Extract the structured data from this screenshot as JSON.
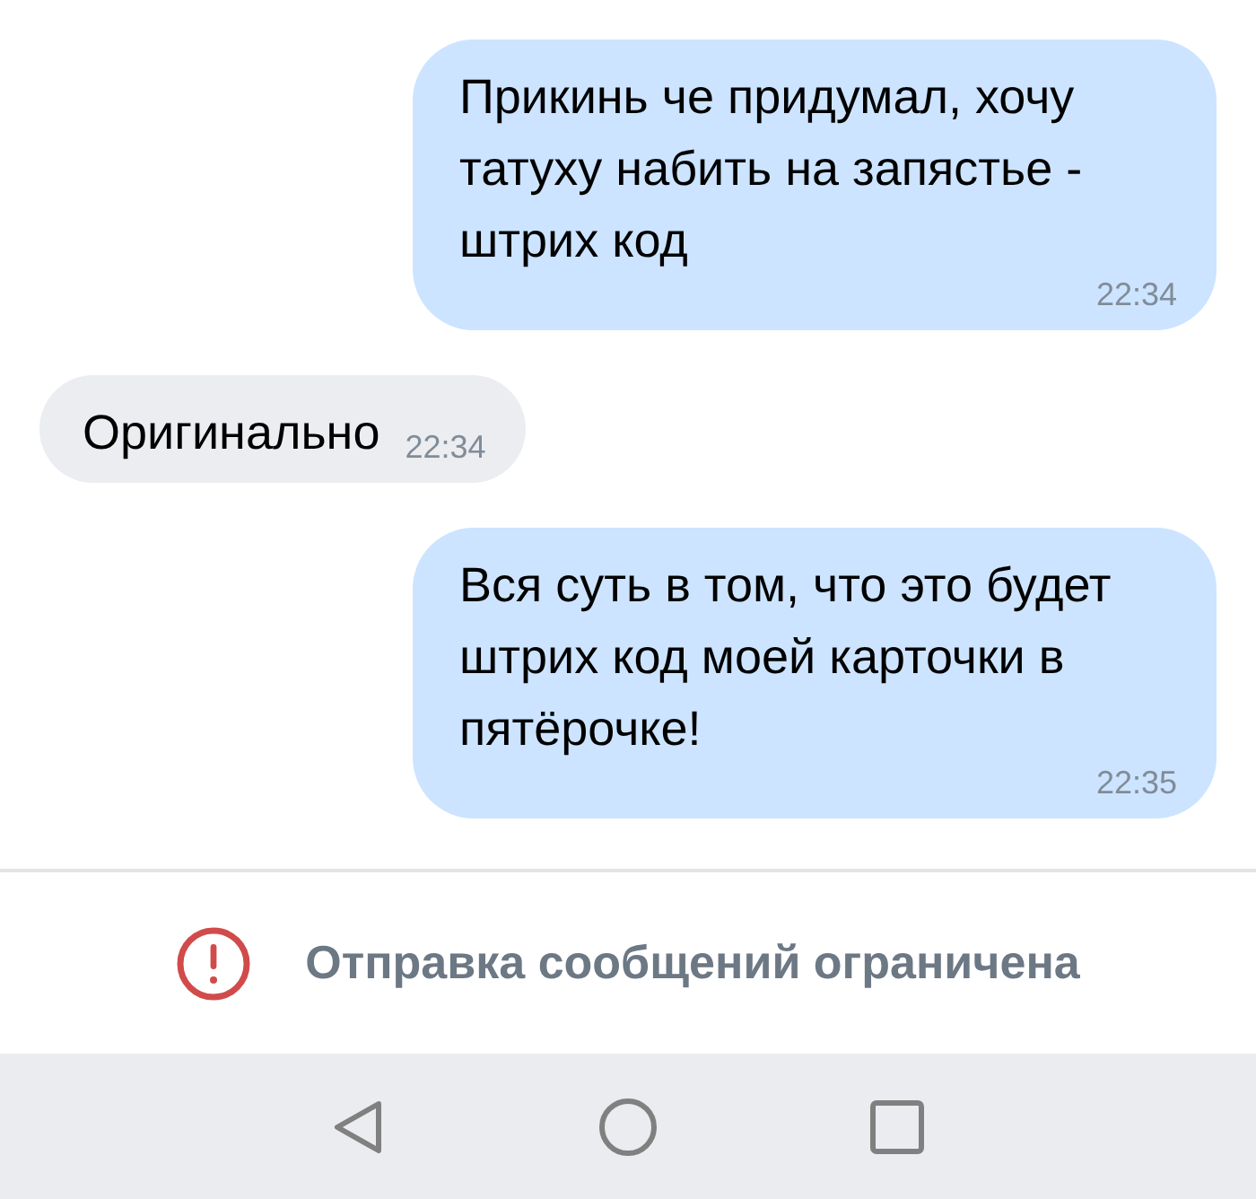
{
  "messages": [
    {
      "kind": "outgoing",
      "text": "Прикинь че придумал, хочу татуху набить на запястье - штрих код",
      "time": "22:34"
    },
    {
      "kind": "incoming",
      "text": "Оригинально",
      "time": "22:34"
    },
    {
      "kind": "outgoing",
      "text": "Вся суть в том, что это будет штрих код моей карточки в пятёрочке!",
      "time": "22:35"
    }
  ],
  "notice": {
    "text": "Отправка сообщений ограничена"
  }
}
